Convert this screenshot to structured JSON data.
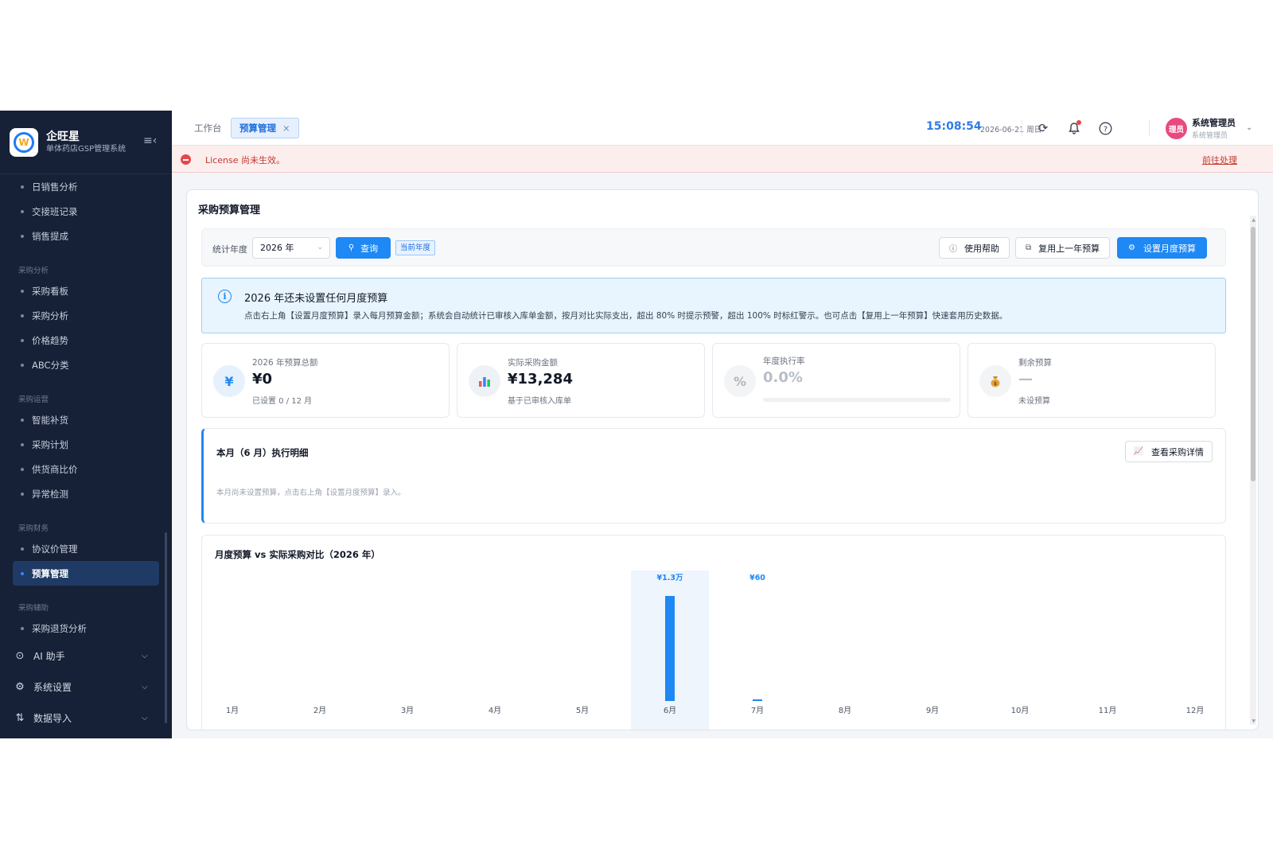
{
  "brand": {
    "name": "企旺星",
    "subtitle": "单体药店GSP管理系统"
  },
  "sidebar": {
    "groups": [
      {
        "label": "",
        "items": [
          "日销售分析",
          "交接班记录",
          "销售提成"
        ]
      },
      {
        "label": "采购分析",
        "items": [
          "采购看板",
          "采购分析",
          "价格趋势",
          "ABC分类"
        ]
      },
      {
        "label": "采购运营",
        "items": [
          "智能补货",
          "采购计划",
          "供货商比价",
          "异常检测"
        ]
      },
      {
        "label": "采购财务",
        "items": [
          "协议价管理",
          "预算管理"
        ]
      },
      {
        "label": "采购辅助",
        "items": [
          "采购退货分析"
        ]
      }
    ],
    "active_item": "预算管理",
    "top_items": [
      {
        "label": "AI 助手",
        "icon": "robot-icon"
      },
      {
        "label": "系统设置",
        "icon": "gear-icon"
      },
      {
        "label": "数据导入",
        "icon": "import-icon"
      }
    ]
  },
  "topbar": {
    "tab_work": "工作台",
    "tab_active": "预算管理",
    "time": "15:08:54",
    "date": "2026-06-21 周日",
    "avatar_text": "理员",
    "user_name": "系统管理员",
    "user_role": "系统管理员"
  },
  "banner": {
    "text": "License 尚未生效。",
    "link": "前往处理",
    "color": "#c0392b"
  },
  "page": {
    "title": "采购预算管理",
    "filter": {
      "label": "统计年度",
      "year_value": "2026 年",
      "query_button": "查询",
      "current_year_tag": "当前年度",
      "help_button": "使用帮助",
      "copy_button": "复用上一年预算",
      "set_button": "设置月度预算"
    },
    "info": {
      "title": "2026 年还未设置任何月度预算",
      "text": "点击右上角【设置月度预算】录入每月预算金额；系统会自动统计已审核入库单金额，按月对比实际支出，超出 80% 时提示预警，超出 100% 时标红警示。也可点击【复用上一年预算】快速套用历史数据。"
    },
    "stats": [
      {
        "label": "2026 年预算总额",
        "value": "¥0",
        "sub": "已设置 0 / 12 月",
        "icon": "yen-icon"
      },
      {
        "label": "实际采购金额",
        "value": "¥13,284",
        "sub": "基于已审核入库单",
        "icon": "bar-chart-icon"
      },
      {
        "label": "年度执行率",
        "value": "0.0%",
        "sub": "",
        "icon": "percent-icon",
        "progress": 0
      },
      {
        "label": "剩余预算",
        "value": "—",
        "sub": "未设预算",
        "icon": "money-bag-icon"
      }
    ],
    "month_detail": {
      "title": "本月（6 月）执行明细",
      "empty_text": "本月尚未设置预算，点击右上角【设置月度预算】录入。",
      "button": "查看采购详情"
    }
  },
  "chart_data": {
    "type": "bar",
    "title": "月度预算 vs 实际采购对比（2026 年）",
    "categories": [
      "1月",
      "2月",
      "3月",
      "4月",
      "5月",
      "6月",
      "7月",
      "8月",
      "9月",
      "10月",
      "11月",
      "12月"
    ],
    "series": [
      {
        "values": [
          0,
          0,
          0,
          0,
          0,
          13224,
          60,
          0,
          0,
          0,
          0,
          0
        ]
      }
    ],
    "data_labels": {
      "5": "¥1.3万",
      "6": "¥60"
    },
    "highlight_category": "6月",
    "colors": {
      "bar": "#1e88f4",
      "highlight_bg": "#eef5fd",
      "label": "#1e88f4"
    }
  }
}
